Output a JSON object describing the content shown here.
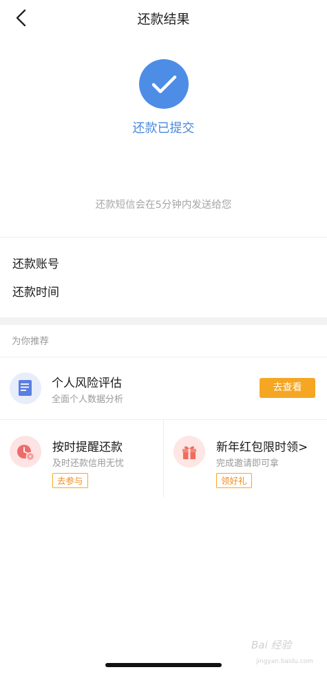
{
  "header": {
    "title": "还款结果"
  },
  "status": {
    "message": "还款已提交",
    "sms_note": "还款短信会在5分钟内发送给您"
  },
  "details": {
    "account_label": "还款账号",
    "time_label": "还款时间"
  },
  "recommend": {
    "header": "为你推荐",
    "risk_card": {
      "title": "个人风险评估",
      "subtitle": "全面个人数据分析",
      "button": "去查看"
    },
    "reminder_card": {
      "title": "按时提醒还款",
      "subtitle": "及时还款信用无忧",
      "tag": "去参与"
    },
    "redpacket_card": {
      "title": "新年红包限时领>",
      "subtitle": "完成邀请即可拿",
      "tag": "领好礼"
    }
  },
  "watermark": {
    "text": "Bai 经验",
    "sub": "jingyan.baidu.com"
  },
  "colors": {
    "accent_blue": "#4d8de6",
    "orange": "#f5a623",
    "pink_bg": "#fde3e3",
    "icon_red": "#ef6a6a"
  },
  "icons": [
    "back-chevron",
    "check",
    "document",
    "alarm-clock",
    "gift"
  ]
}
